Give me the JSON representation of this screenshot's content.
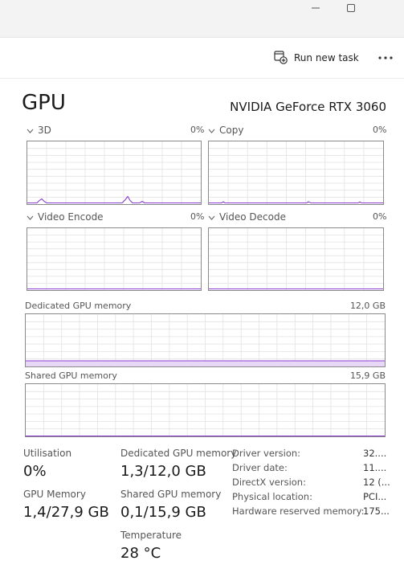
{
  "window": {
    "minimize_icon": "minimize-icon",
    "maximize_icon": "maximize-icon"
  },
  "toolbar": {
    "run_new_task_label": "Run new task",
    "run_new_task_icon": "run-task-icon",
    "more_icon": "ellipsis-icon"
  },
  "header": {
    "title": "GPU",
    "gpu_name": "NVIDIA GeForce RTX 3060"
  },
  "engines": [
    {
      "label": "3D",
      "percent": "0%"
    },
    {
      "label": "Copy",
      "percent": "0%"
    },
    {
      "label": "Video Encode",
      "percent": "0%"
    },
    {
      "label": "Video Decode",
      "percent": "0%"
    }
  ],
  "memory_graphs": {
    "dedicated": {
      "label": "Dedicated GPU memory",
      "total": "12,0 GB",
      "fill_fraction": 0.108
    },
    "shared": {
      "label": "Shared GPU memory",
      "total": "15,9 GB",
      "fill_fraction": 0.006
    }
  },
  "stats": {
    "utilisation": {
      "label": "Utilisation",
      "value": "0%"
    },
    "gpu_memory": {
      "label": "GPU Memory",
      "value": "1,4/27,9 GB"
    },
    "dedicated_memory": {
      "label": "Dedicated GPU memory",
      "value": "1,3/12,0 GB"
    },
    "shared_memory": {
      "label": "Shared GPU memory",
      "value": "0,1/15,9 GB"
    },
    "temperature": {
      "label": "Temperature",
      "value": "28 °C"
    }
  },
  "details": [
    {
      "label": "Driver version:",
      "value": "32...."
    },
    {
      "label": "Driver date:",
      "value": "11...."
    },
    {
      "label": "DirectX version:",
      "value": "12 (..."
    },
    {
      "label": "Physical location:",
      "value": "PCI..."
    },
    {
      "label": "Hardware reserved memory:",
      "value": "175..."
    }
  ],
  "colors": {
    "accent": "#8b3fd0",
    "accent_fill": "#e9d7f8",
    "grid": "#e2e2e2",
    "border": "#8a8a8a"
  }
}
